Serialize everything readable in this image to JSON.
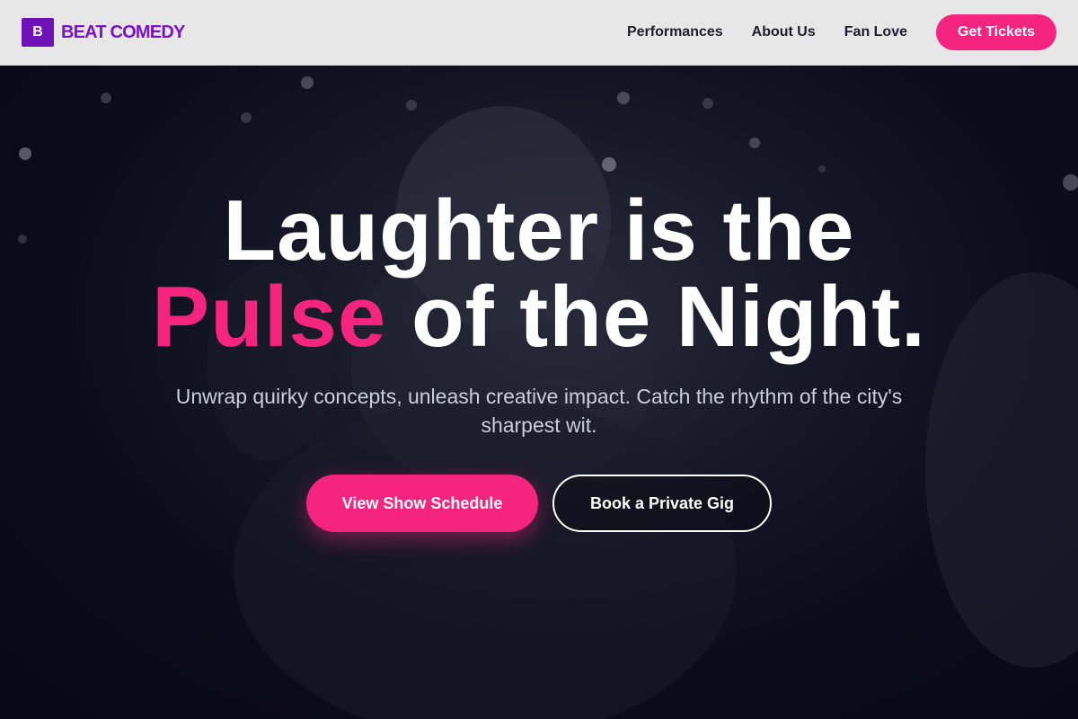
{
  "brand": {
    "mark": "B",
    "name": "BEAT COMEDY"
  },
  "nav": {
    "links": [
      "Performances",
      "About Us",
      "Fan Love"
    ],
    "cta": "Get Tickets"
  },
  "hero": {
    "title_line1": "Laughter is the",
    "title_accent": "Pulse",
    "title_line2_rest": " of the Night.",
    "subtitle": "Unwrap quirky concepts, unleash creative impact. Catch the rhythm of the city's sharpest wit.",
    "primary_button": "View Show Schedule",
    "secondary_button": "Book a Private Gig"
  },
  "colors": {
    "accent": "#f4247f",
    "brand": "#6f12b8",
    "nav_bg": "#e7e7e7",
    "hero_bg": "#0b0d1c"
  }
}
